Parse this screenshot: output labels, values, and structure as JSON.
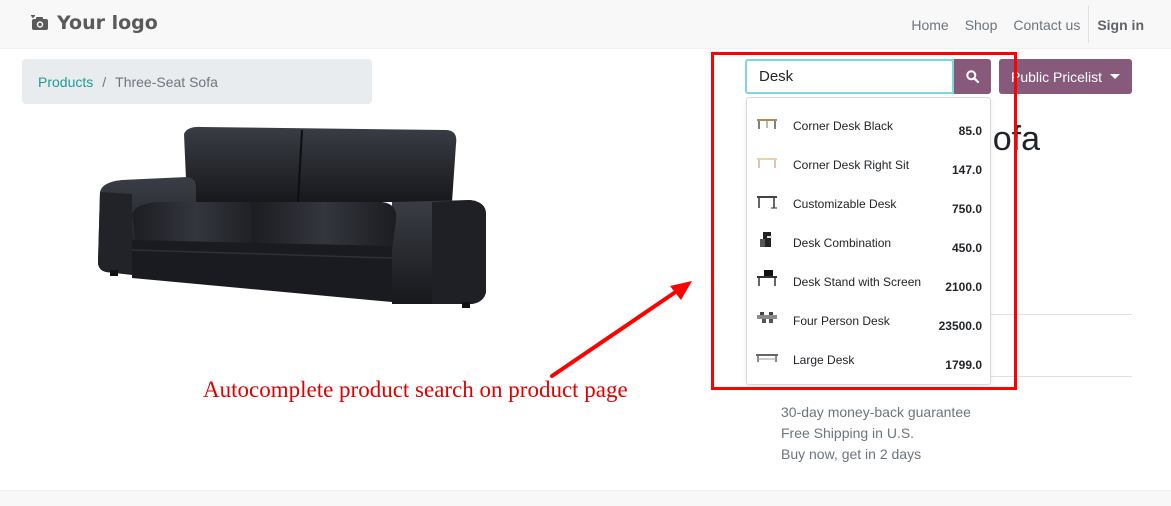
{
  "navbar": {
    "logo_text": "Your logo",
    "logo_icon": "camera-icon",
    "links": [
      "Home",
      "Shop",
      "Contact us"
    ],
    "signin": "Sign in"
  },
  "breadcrumb": {
    "link": "Products",
    "separator": "/",
    "current": "Three-Seat Sofa"
  },
  "product": {
    "title_fragment": "ofa",
    "guarantees": [
      "30-day money-back guarantee",
      "Free Shipping in U.S.",
      "Buy now, get in 2 days"
    ]
  },
  "search": {
    "value": "Desk",
    "button_icon": "search-icon"
  },
  "pricelist": {
    "label": "Public Pricelist",
    "icon": "caret-down-icon"
  },
  "dropdown": {
    "items": [
      {
        "name": "Corner Desk Black",
        "price": "85.0"
      },
      {
        "name": "Corner Desk Right Sit",
        "price": "147.0"
      },
      {
        "name": "Customizable Desk",
        "price": "750.0"
      },
      {
        "name": "Desk Combination",
        "price": "450.0"
      },
      {
        "name": "Desk Stand with Screen",
        "price": "2100.0"
      },
      {
        "name": "Four Person Desk",
        "price": "23500.0"
      },
      {
        "name": "Large Desk",
        "price": "1799.0"
      }
    ]
  },
  "annotation": {
    "text": "Autocomplete product search on product page",
    "color": "#ff0000"
  },
  "colors": {
    "accent": "#875a7b",
    "link": "#1f9a94",
    "focus": "#7fd6de"
  }
}
